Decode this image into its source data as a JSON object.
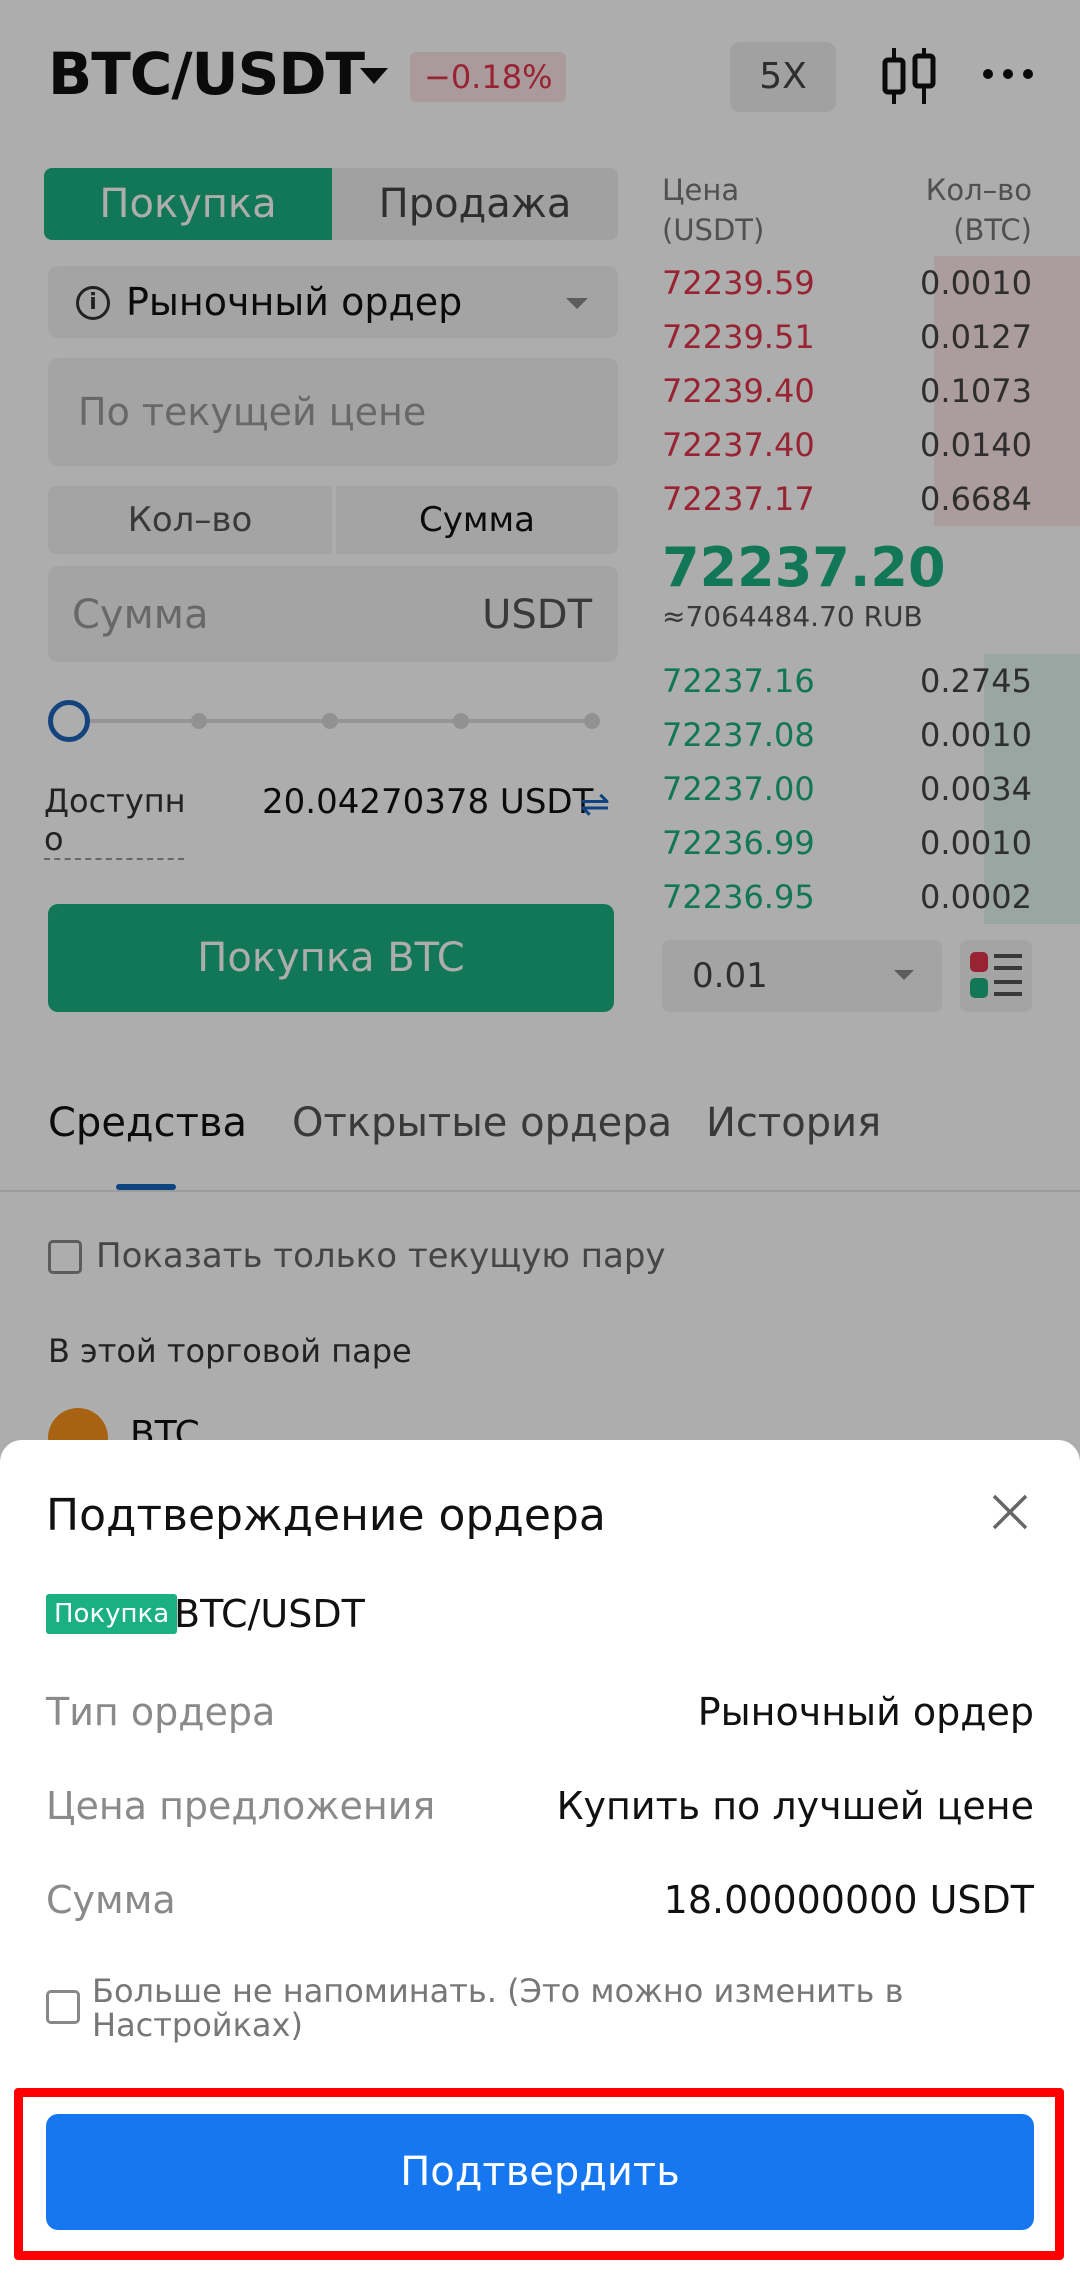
{
  "header": {
    "pair": "BTC/USDT",
    "change": "−0.18%",
    "leverage": "5X"
  },
  "trade": {
    "buy_tab": "Покупка",
    "sell_tab": "Продажа",
    "order_type": "Рыночный ордер",
    "price_placeholder": "По текущей цене",
    "qty_tab": "Кол–во",
    "sum_tab": "Сумма",
    "amount_placeholder": "Сумма",
    "amount_unit": "USDT",
    "slider_percent": 0,
    "available_label_1": "Доступн",
    "available_label_2": "о",
    "available_value": "20.04270378 USDT",
    "buy_button": "Покупка BTC"
  },
  "orderbook": {
    "price_header_1": "Цена",
    "price_header_2": "(USDT)",
    "qty_header_1": "Кол–во",
    "qty_header_2": "(BTC)",
    "asks": [
      {
        "price": "72239.59",
        "qty": "0.0010",
        "depth": 0.35
      },
      {
        "price": "72239.51",
        "qty": "0.0127",
        "depth": 0.35
      },
      {
        "price": "72239.40",
        "qty": "0.1073",
        "depth": 0.35
      },
      {
        "price": "72237.40",
        "qty": "0.0140",
        "depth": 0.35
      },
      {
        "price": "72237.17",
        "qty": "0.6684",
        "depth": 0.35
      }
    ],
    "last_price": "72237.20",
    "last_price_fiat": "≈7064484.70 RUB",
    "bids": [
      {
        "price": "72237.16",
        "qty": "0.2745",
        "depth": 0.23
      },
      {
        "price": "72237.08",
        "qty": "0.0010",
        "depth": 0.23
      },
      {
        "price": "72237.00",
        "qty": "0.0034",
        "depth": 0.23
      },
      {
        "price": "72236.99",
        "qty": "0.0010",
        "depth": 0.23
      },
      {
        "price": "72236.95",
        "qty": "0.0002",
        "depth": 0.23
      }
    ],
    "depth_value": "0.01"
  },
  "bottom_tabs": {
    "assets": "Средства",
    "open_orders": "Открытые ордера",
    "history": "История"
  },
  "assets": {
    "only_current_pair": "Показать только текущую пару",
    "section_label": "В этой торговой паре",
    "coin": "BTC"
  },
  "dialog": {
    "title": "Подтверждение ордера",
    "side_badge": "Покупка",
    "pair": "BTC/USDT",
    "rows": [
      {
        "label": "Тип ордера",
        "value": "Рыночный ордер"
      },
      {
        "label": "Цена предложения",
        "value": "Купить по лучшей цене"
      },
      {
        "label": "Сумма",
        "value": "18.00000000 USDT"
      }
    ],
    "dont_remind": "Больше не напоминать. (Это можно изменить в Настройках)",
    "confirm_button": "Подтвердить"
  },
  "colors": {
    "buy_green": "#1bb081",
    "sell_red": "#e0344b",
    "confirm_blue": "#1677f0",
    "highlight_red": "#ff0000"
  }
}
